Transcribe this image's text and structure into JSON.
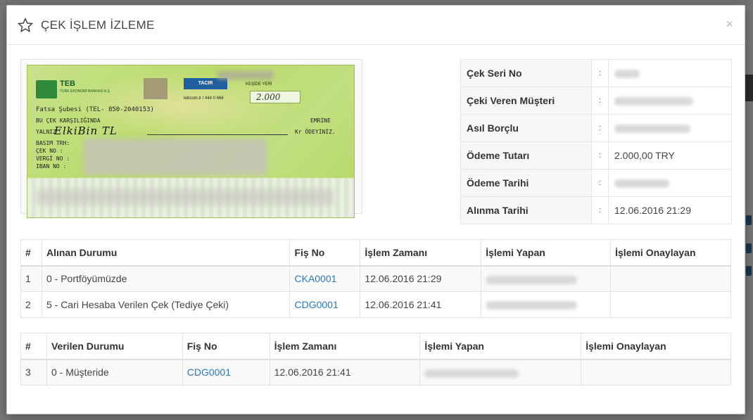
{
  "modal": {
    "title": "ÇEK İŞLEM İZLEME",
    "close_glyph": "×"
  },
  "cheque_image": {
    "bank_name": "TEB",
    "bank_sub": "TÜRK EKONOMİ BANKASI A.Ş.",
    "branch": "Fatsa Şubesi (TEL- 850-2040153)",
    "tacir": "TACIR",
    "place_date": "KEŞİDE YERİ",
    "phone": "tebcom.tr / 444 0 666",
    "amount": "2.000",
    "bu_cek": "BU ÇEK KARŞILIĞINDA",
    "emrine": "EMRİNE",
    "yalniz": "YALNIZ",
    "handwritten": "ElkiBin TL",
    "odeyiniz": "Kr ÖDEYİNİZ.",
    "fields": [
      "BASIM TRH:",
      "ÇEK NO :",
      "VERGİ NO :",
      "IBAN NO :"
    ]
  },
  "info": {
    "rows": [
      {
        "label": "Çek Seri No",
        "sep": ":",
        "value": ""
      },
      {
        "label": "Çeki Veren Müşteri",
        "sep": ":",
        "value": ""
      },
      {
        "label": "Asıl Borçlu",
        "sep": ":",
        "value": ""
      },
      {
        "label": "Ödeme Tutarı",
        "sep": ":",
        "value": "2.000,00 TRY"
      },
      {
        "label": "Ödeme Tarihi",
        "sep": ":",
        "value": ""
      },
      {
        "label": "Alınma Tarihi",
        "sep": ":",
        "value": "12.06.2016 21:29"
      }
    ]
  },
  "received": {
    "headers": [
      "#",
      "Alınan Durumu",
      "Fiş No",
      "İşlem Zamanı",
      "İşlemi Yapan",
      "İşlemi Onaylayan"
    ],
    "rows": [
      {
        "no": "1",
        "status": "0 - Portföyümüzde",
        "fis": "CKA0001",
        "time": "12.06.2016 21:29",
        "by": "",
        "approved": ""
      },
      {
        "no": "2",
        "status": "5 - Cari Hesaba Verilen Çek (Tediye Çeki)",
        "fis": "CDG0001",
        "time": "12.06.2016 21:41",
        "by": "",
        "approved": ""
      }
    ]
  },
  "given": {
    "headers": [
      "#",
      "Verilen Durumu",
      "Fiş No",
      "İşlem Zamanı",
      "İşlemi Yapan",
      "İşlemi Onaylayan"
    ],
    "rows": [
      {
        "no": "3",
        "status": "0 - Müşteride",
        "fis": "CDG0001",
        "time": "12.06.2016 21:41",
        "by": "",
        "approved": ""
      }
    ]
  },
  "colors": {
    "link": "#2a7ab8",
    "cheque_green": "#b9db6d"
  }
}
